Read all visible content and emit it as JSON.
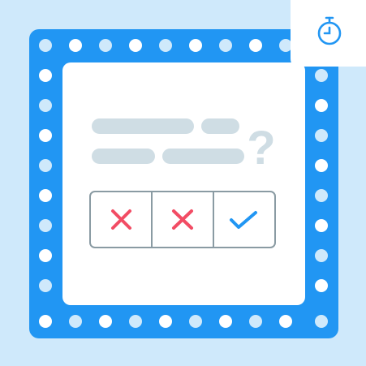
{
  "illustration": {
    "background_color": "#cfe9fb",
    "frame_color": "#2196f3",
    "card_color": "#ffffff",
    "bulb_colors": [
      "#ffffff",
      "#cfe9fb"
    ],
    "text_placeholder_color": "#cfdde4",
    "question_mark": "?",
    "question_mark_color": "#cfdde4",
    "timer_badge": {
      "icon": "stopwatch-icon",
      "color": "#2196f3",
      "background": "#ffffff"
    },
    "answer_choices": [
      {
        "icon": "cross-icon",
        "state": "wrong",
        "color": "#f24c64"
      },
      {
        "icon": "cross-icon",
        "state": "wrong",
        "color": "#f24c64"
      },
      {
        "icon": "check-icon",
        "state": "correct",
        "color": "#2196f3"
      }
    ],
    "choice_border_color": "#8a9ba3"
  }
}
